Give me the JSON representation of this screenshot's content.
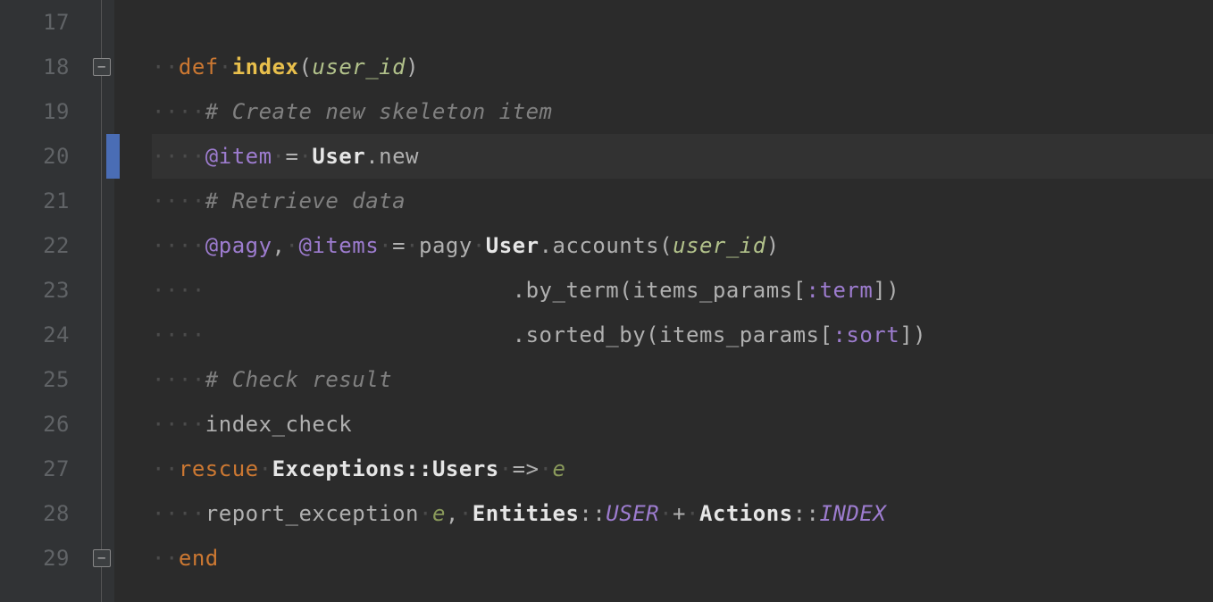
{
  "line_height": 50,
  "gutter": [
    "17",
    "18",
    "19",
    "20",
    "21",
    "22",
    "23",
    "24",
    "25",
    "26",
    "27",
    "28",
    "29"
  ],
  "fold_start_row": 1,
  "fold_end_row": 12,
  "caret_row": 3,
  "code": {
    "ws2": "··",
    "ws4": "····",
    "dot": "·",
    "kw_def": "def",
    "fn_index": "index",
    "lp": "(",
    "rp": ")",
    "param_user_id": "user_id",
    "cmt_create": "# Create new skeleton item",
    "ivar_item": "@item",
    "eq": "=",
    "cls_user": "User",
    "dot_op": ".",
    "m_new": "new",
    "cmt_retrieve": "# Retrieve data",
    "ivar_pagy": "@pagy",
    "comma": ",",
    "ivar_items": "@items",
    "m_pagy": "pagy",
    "m_accounts": "accounts",
    "m_by_term": "by_term",
    "m_sorted_by": "sorted_by",
    "id_items_params": "items_params",
    "sym_term": ":term",
    "sym_sort": ":sort",
    "lb": "[",
    "rb": "]",
    "cmt_check": "# Check result",
    "m_index_check": "index_check",
    "kw_rescue": "rescue",
    "cls_exceptions": "Exceptions",
    "scope": "::",
    "cls_users": "Users",
    "arrow": "=>",
    "var_e": "e",
    "m_report": "report_exception",
    "cls_entities": "Entities",
    "const_user": "USER",
    "plus": "+",
    "cls_actions": "Actions",
    "const_index": "INDEX",
    "kw_end": "end"
  }
}
